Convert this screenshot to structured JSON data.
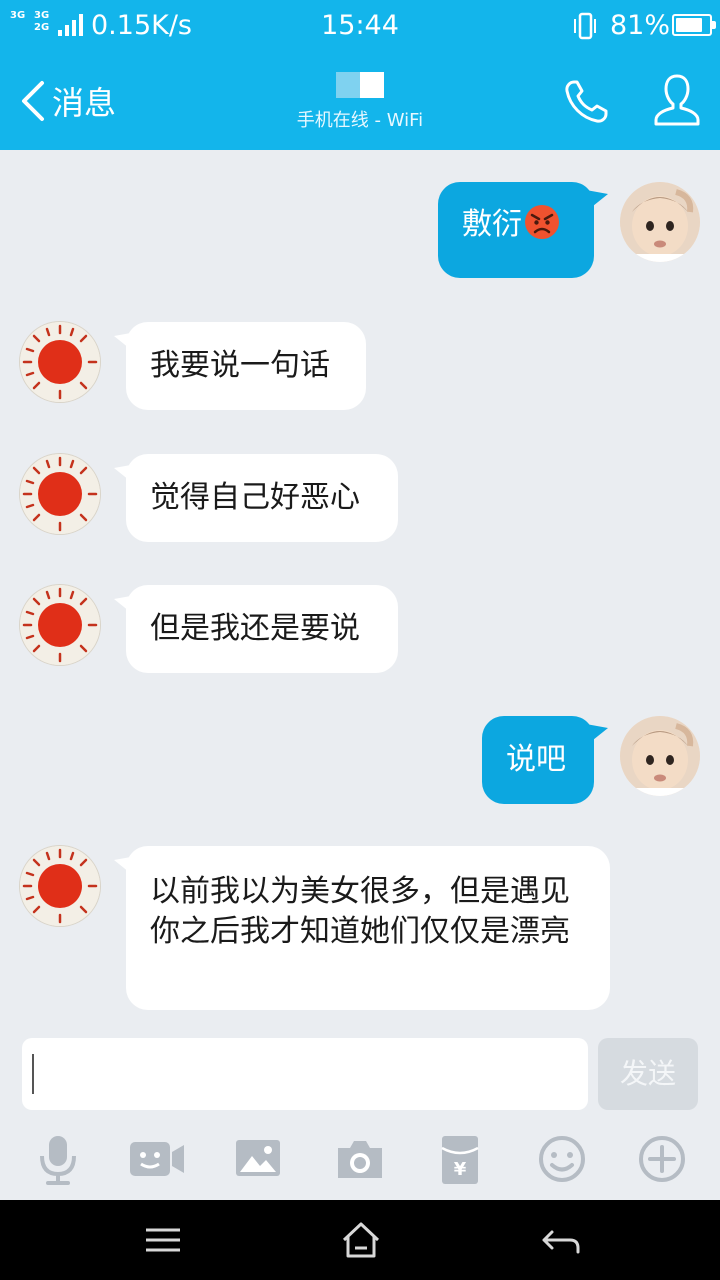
{
  "status_bar": {
    "signal_top": "3G",
    "signal_mid": "3G",
    "signal_bottom": "2G",
    "net_speed": "0.15K/s",
    "time": "15:44",
    "battery_percent": "81%",
    "battery_level": 0.81
  },
  "title_bar": {
    "back_label": "消息",
    "contact_status": "手机在线 - WiFi",
    "call_icon": "phone-icon",
    "profile_icon": "person-icon"
  },
  "messages": [
    {
      "side": "out",
      "text": "敷衍",
      "emoji": "angry-face"
    },
    {
      "side": "in",
      "text": "我要说一句话"
    },
    {
      "side": "in",
      "text": "觉得自己好恶心"
    },
    {
      "side": "in",
      "text": "但是我还是要说"
    },
    {
      "side": "out",
      "text": "说吧"
    },
    {
      "side": "in",
      "text": "以前我以为美女很多，但是遇见你之后我才知道她们仅仅是漂亮"
    }
  ],
  "input": {
    "value": "",
    "send_label": "发送"
  },
  "toolbar": [
    "microphone-icon",
    "video-chat-icon",
    "image-icon",
    "camera-icon",
    "red-packet-icon",
    "emoji-icon",
    "plus-icon"
  ],
  "nav": [
    "menu-icon",
    "home-icon",
    "back-icon"
  ],
  "colors": {
    "accent": "#13b5eb",
    "outgoing_bubble": "#0ca7e0",
    "incoming_bubble": "#ffffff",
    "background": "#eaedf1"
  }
}
